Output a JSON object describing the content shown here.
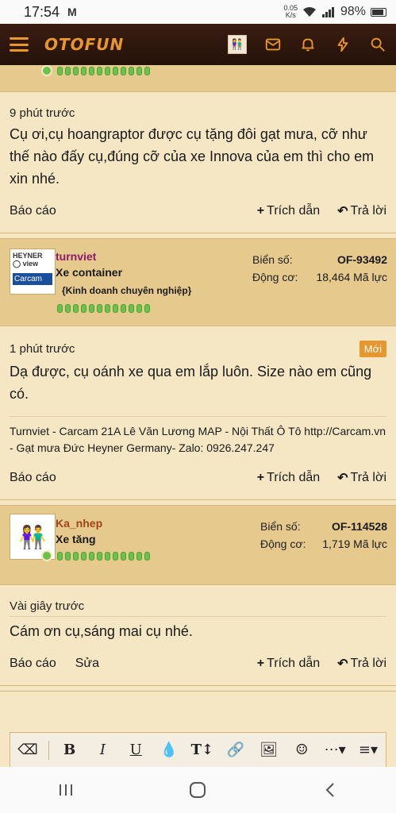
{
  "status_bar": {
    "time": "17:54",
    "speed_top": "0.05",
    "speed_bottom": "K/s",
    "battery": "98%"
  },
  "header": {
    "logo": "OTOFUN"
  },
  "posts": [
    {
      "time": "9 phút trước",
      "message": "Cụ ơi,cụ hoangraptor được cụ tặng đôi gạt mưa, cỡ như thế nào đấy cụ,đúng cỡ của xe Innova của em thì cho em xin nhé.",
      "report": "Báo cáo",
      "quote": "Trích dẫn",
      "reply": "Trả lời"
    },
    {
      "username": "turnviet",
      "user_title": "Xe container",
      "user_banner": "{Kinh doanh chuyên nghiệp}",
      "plate_label": "Biển số:",
      "plate": "OF-93492",
      "engine_label": "Động cơ:",
      "engine": "18,464 Mã lực",
      "time": "1 phút trước",
      "new_badge": "Mới",
      "message": "Dạ được, cụ oánh xe qua em lắp luôn. Size nào em cũng có.",
      "signature": "Turnviet - Carcam 21A Lê Văn Lương MAP - Nội Thất Ô Tô http://Carcam.vn - Gạt mưa Đức Heyner Germany- Zalo: 0926.247.247",
      "report": "Báo cáo",
      "quote": "Trích dẫn",
      "reply": "Trả lời",
      "avatar_text": "Carcam"
    },
    {
      "username": "Ka_nhep",
      "user_title": "Xe tăng",
      "plate_label": "Biển số:",
      "plate": "OF-114528",
      "engine_label": "Động cơ:",
      "engine": "1,719 Mã lực",
      "time": "Vài giây trước",
      "message": "Cám ơn cụ,sáng mai cụ nhé.",
      "report": "Báo cáo",
      "edit": "Sửa",
      "quote": "Trích dẫn",
      "reply": "Trả lời"
    }
  ],
  "colors": {
    "accent": "#e8962e",
    "header_bg": "#2c150b",
    "post_bg": "#f5e7c4",
    "user_bar": "#e6c98c",
    "username_turnviet": "#8a1a6a",
    "username_kanhep": "#a0431a"
  }
}
